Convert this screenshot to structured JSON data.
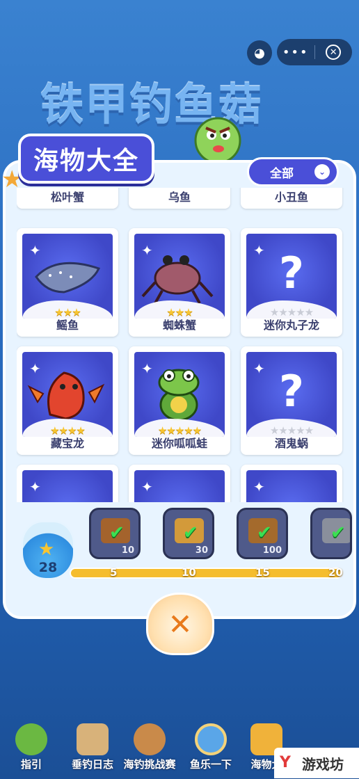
{
  "header": {
    "game_title": "铁甲钓鱼菇",
    "capsule_more": "•••"
  },
  "panel": {
    "title": "海物大全",
    "filter_label": "全部",
    "cards_top_row": [
      {
        "name": "松叶蟹"
      },
      {
        "name": "乌鱼"
      },
      {
        "name": "小丑鱼"
      }
    ],
    "cards": [
      {
        "name": "鳐鱼",
        "stars_on": 3,
        "stars_total": 3,
        "unknown": false
      },
      {
        "name": "蜘蛛蟹",
        "stars_on": 3,
        "stars_total": 3,
        "unknown": false
      },
      {
        "name": "迷你丸子龙",
        "stars_on": 0,
        "stars_total": 5,
        "unknown": true
      },
      {
        "name": "藏宝龙",
        "stars_on": 4,
        "stars_total": 4,
        "unknown": false
      },
      {
        "name": "迷你呱呱蛙",
        "stars_on": 5,
        "stars_total": 5,
        "unknown": false
      },
      {
        "name": "酒鬼蜗",
        "stars_on": 0,
        "stars_total": 5,
        "unknown": true
      }
    ]
  },
  "progress": {
    "collected": "28",
    "rewards": [
      {
        "amount": "10",
        "milestone": "5"
      },
      {
        "amount": "30",
        "milestone": "10"
      },
      {
        "amount": "100",
        "milestone": "15"
      },
      {
        "amount": "",
        "milestone": "20"
      }
    ]
  },
  "nav": {
    "items": [
      {
        "label": "指引",
        "icon": "frog-guide-icon"
      },
      {
        "label": "垂钓日志",
        "icon": "fishing-log-icon"
      },
      {
        "label": "海钓挑战赛",
        "icon": "challenge-icon"
      },
      {
        "label": "鱼乐一下",
        "icon": "wheel-icon"
      },
      {
        "label": "海物大",
        "icon": "encyclopedia-icon"
      }
    ]
  },
  "watermark": {
    "logo": "Y",
    "text": "游戏坊"
  },
  "colors": {
    "accent": "#4a4fd8",
    "star": "#f7c531",
    "progress": "#f5bd2e",
    "check": "#3be052"
  }
}
